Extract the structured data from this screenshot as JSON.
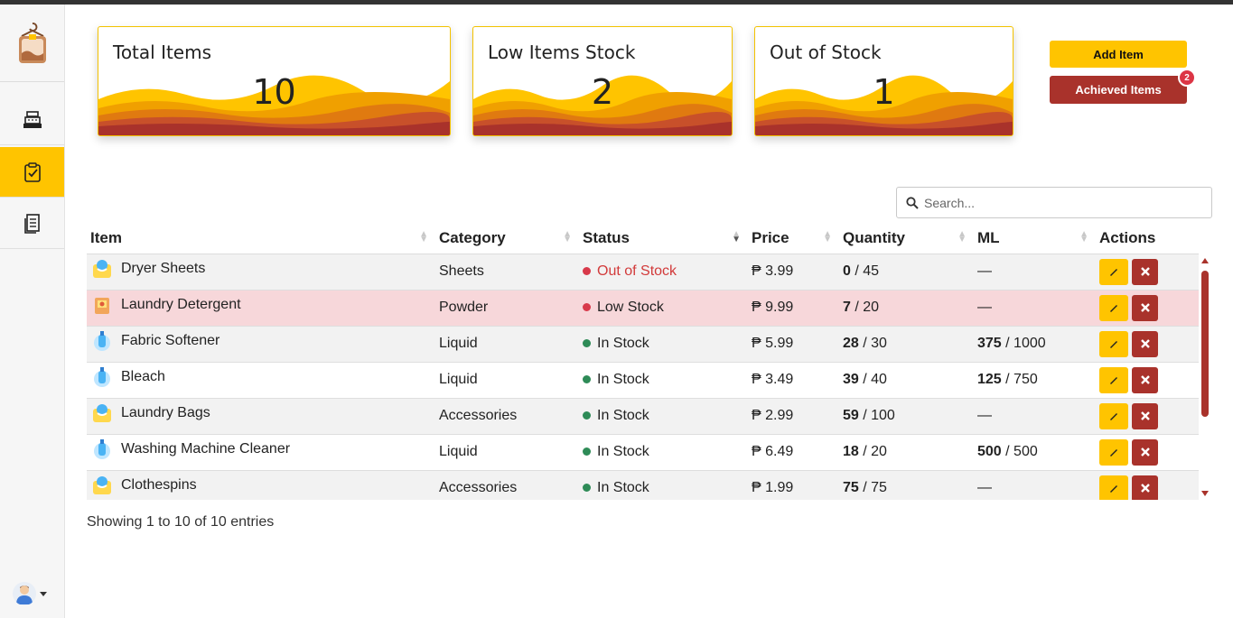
{
  "sidebar": {
    "items": [
      {
        "name": "pos",
        "icon": "cash-register-icon"
      },
      {
        "name": "inventory",
        "icon": "clipboard-check-icon",
        "active": true
      },
      {
        "name": "reports",
        "icon": "receipt-icon"
      }
    ],
    "user_icon": "user-avatar"
  },
  "cards": [
    {
      "title": "Total Items",
      "value": "10"
    },
    {
      "title": "Low Items Stock",
      "value": "2"
    },
    {
      "title": "Out of Stock",
      "value": "1"
    }
  ],
  "buttons": {
    "add_item": "Add Item",
    "achieved_items": "Achieved Items",
    "achieved_badge": "2"
  },
  "search": {
    "placeholder": "Search..."
  },
  "table": {
    "headers": [
      "Item",
      "Category",
      "Status",
      "Price",
      "Quantity",
      "ML",
      "Actions"
    ],
    "rows": [
      {
        "item": "Dryer Sheets",
        "category": "Sheets",
        "status": "Out of Stock",
        "price": "₱ 3.99",
        "qty": "0",
        "qty_max": " / 45",
        "ml": "—",
        "ml_max": ""
      },
      {
        "item": "Laundry Detergent",
        "category": "Powder",
        "status": "Low Stock",
        "price": "₱ 9.99",
        "qty": "7",
        "qty_max": " / 20",
        "ml": "—",
        "ml_max": ""
      },
      {
        "item": "Fabric Softener",
        "category": "Liquid",
        "status": "In Stock",
        "price": "₱ 5.99",
        "qty": "28",
        "qty_max": " / 30",
        "ml": "375",
        "ml_max": " / 1000"
      },
      {
        "item": "Bleach",
        "category": "Liquid",
        "status": "In Stock",
        "price": "₱ 3.49",
        "qty": "39",
        "qty_max": " / 40",
        "ml": "125",
        "ml_max": " / 750"
      },
      {
        "item": "Laundry Bags",
        "category": "Accessories",
        "status": "In Stock",
        "price": "₱ 2.99",
        "qty": "59",
        "qty_max": " / 100",
        "ml": "—",
        "ml_max": ""
      },
      {
        "item": "Washing Machine Cleaner",
        "category": "Liquid",
        "status": "In Stock",
        "price": "₱ 6.49",
        "qty": "18",
        "qty_max": " / 20",
        "ml": "500",
        "ml_max": " / 500"
      },
      {
        "item": "Clothespins",
        "category": "Accessories",
        "status": "In Stock",
        "price": "₱ 1.99",
        "qty": "75",
        "qty_max": " / 75",
        "ml": "—",
        "ml_max": ""
      }
    ]
  },
  "footer": {
    "showing": "Showing 1 to 10 of 10 entries"
  },
  "colors": {
    "accent": "#ffc400",
    "danger": "#a9322b",
    "low_row": "#f7d7da"
  }
}
